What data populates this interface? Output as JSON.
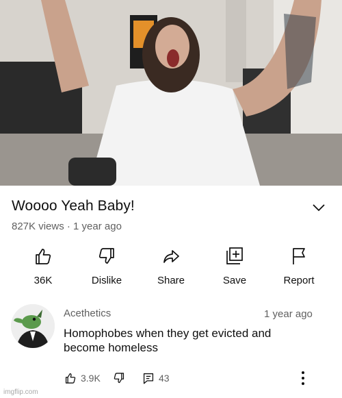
{
  "video": {
    "title": "Woooo Yeah Baby!",
    "meta": "827K views · 1 year ago"
  },
  "actions": [
    {
      "label": "36K",
      "icon": "thumbs-up-icon"
    },
    {
      "label": "Dislike",
      "icon": "thumbs-down-icon"
    },
    {
      "label": "Share",
      "icon": "share-icon"
    },
    {
      "label": "Save",
      "icon": "save-playlist-icon"
    },
    {
      "label": "Report",
      "icon": "flag-icon"
    }
  ],
  "comment": {
    "author": "Acethetics",
    "time": "1 year ago",
    "text": "Homophobes when they get evicted and become homeless",
    "likes": "3.9K",
    "replies": "43"
  },
  "watermark": "imgflip.com",
  "colors": {
    "text_primary": "#0f0f0f",
    "text_secondary": "#606060",
    "background": "#ffffff"
  }
}
